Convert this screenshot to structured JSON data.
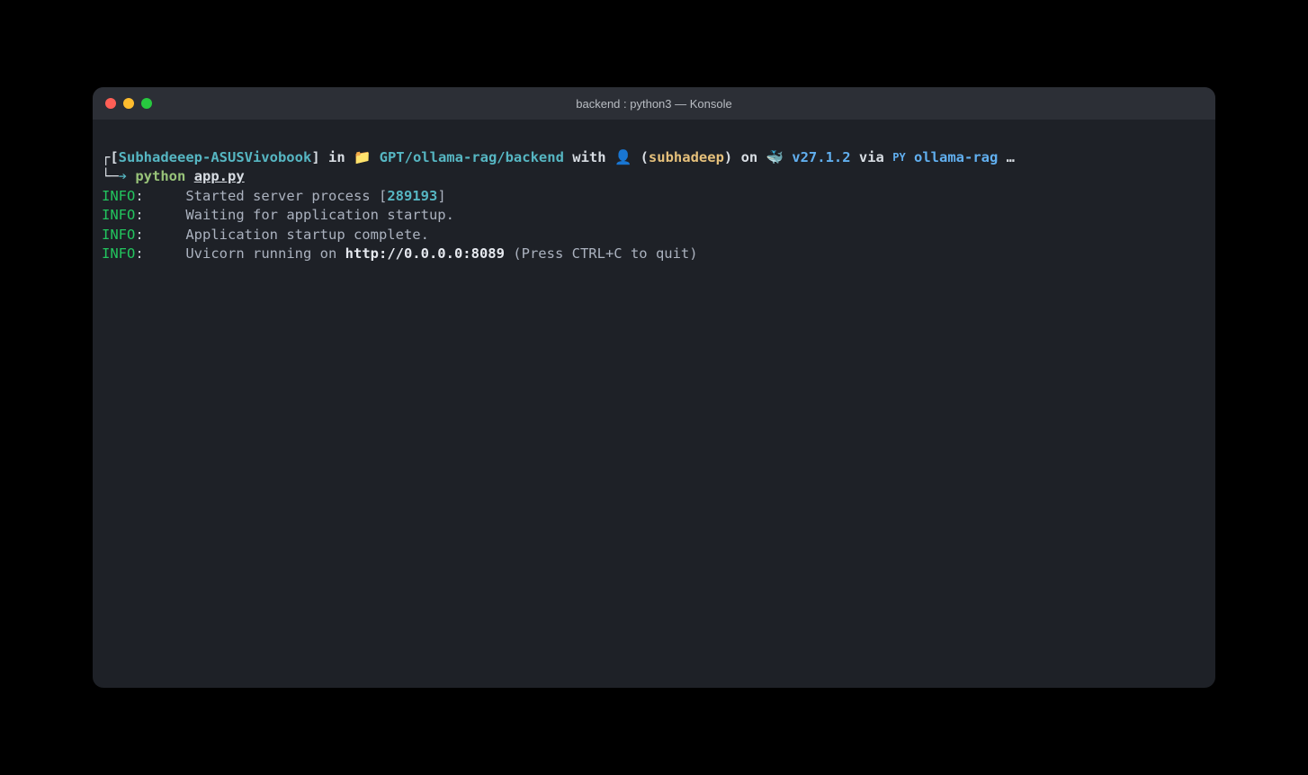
{
  "window": {
    "title": "backend : python3 — Konsole"
  },
  "prompt": {
    "box_top": "┌[",
    "hostname": "Subhadeeep-ASUSVivobook",
    "bracket_close": "]",
    "in_word": " in ",
    "folder_icon": "📁",
    "path": " GPT/ollama-rag/backend",
    "with_word": " with ",
    "user_icon": "👤",
    "user_open": " (",
    "username": "subhadeep",
    "user_close": ")",
    "on_word": " on ",
    "whale_icon": "🐳",
    "version": " v27.1.2",
    "via_word": " via ",
    "py_label": "PY",
    "env_name": " ollama-rag",
    "ellipsis": " …",
    "box_bottom": "└─",
    "arrow": "➔ ",
    "command_bin": "python",
    "command_arg": "app.py"
  },
  "logs": [
    {
      "level": "INFO",
      "colon": ":",
      "pad": "     ",
      "msg_pre": "Started server process [",
      "pid": "289193",
      "msg_post": "]"
    },
    {
      "level": "INFO",
      "colon": ":",
      "pad": "     ",
      "msg": "Waiting for application startup."
    },
    {
      "level": "INFO",
      "colon": ":",
      "pad": "     ",
      "msg": "Application startup complete."
    },
    {
      "level": "INFO",
      "colon": ":",
      "pad": "     ",
      "msg_pre": "Uvicorn running on ",
      "url": "http://0.0.0.0:8089",
      "msg_post": " (Press CTRL+C to quit)"
    }
  ]
}
